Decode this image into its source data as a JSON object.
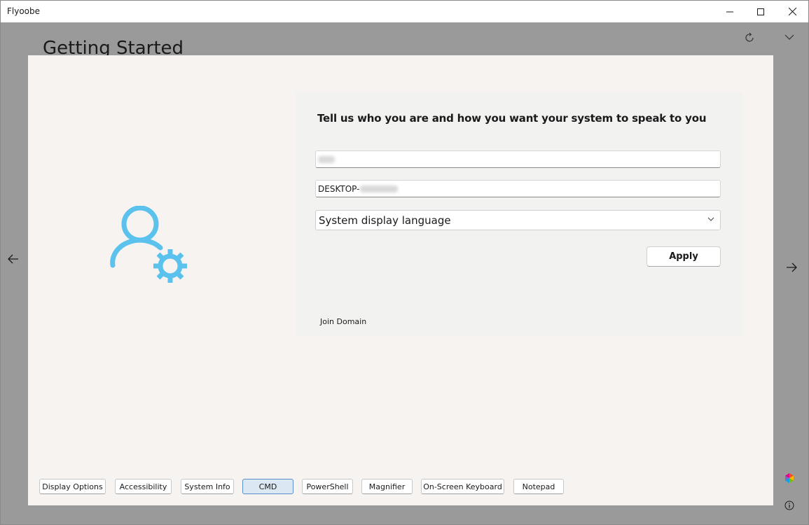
{
  "window": {
    "title": "Flyoobe"
  },
  "page": {
    "heading": "Getting Started"
  },
  "card": {
    "heading": "Tell us who you are and how you want your system to speak to you",
    "device_name_prefix": "DESKTOP-",
    "language_selected": "System display language",
    "apply_label": "Apply",
    "join_domain_label": "Join Domain"
  },
  "toolbar": {
    "buttons": [
      {
        "label": "Display Options"
      },
      {
        "label": "Accessibility"
      },
      {
        "label": "System Info"
      },
      {
        "label": "CMD"
      },
      {
        "label": "PowerShell"
      },
      {
        "label": "Magnifier"
      },
      {
        "label": "On-Screen Keyboard"
      },
      {
        "label": "Notepad"
      }
    ]
  },
  "colors": {
    "accent": "#5bc2ee",
    "active_button": "#dbe8f4",
    "panel_background": "#f7f3f0",
    "card_background": "#f2f2f1",
    "backdrop": "#9a9a9a"
  },
  "icons": {
    "illustration": "user-settings-icon",
    "refresh": "refresh-icon",
    "expand": "chevron-down-icon",
    "back": "arrow-left-icon",
    "forward": "arrow-right-icon",
    "ai": "copilot-icon",
    "info": "info-icon"
  }
}
